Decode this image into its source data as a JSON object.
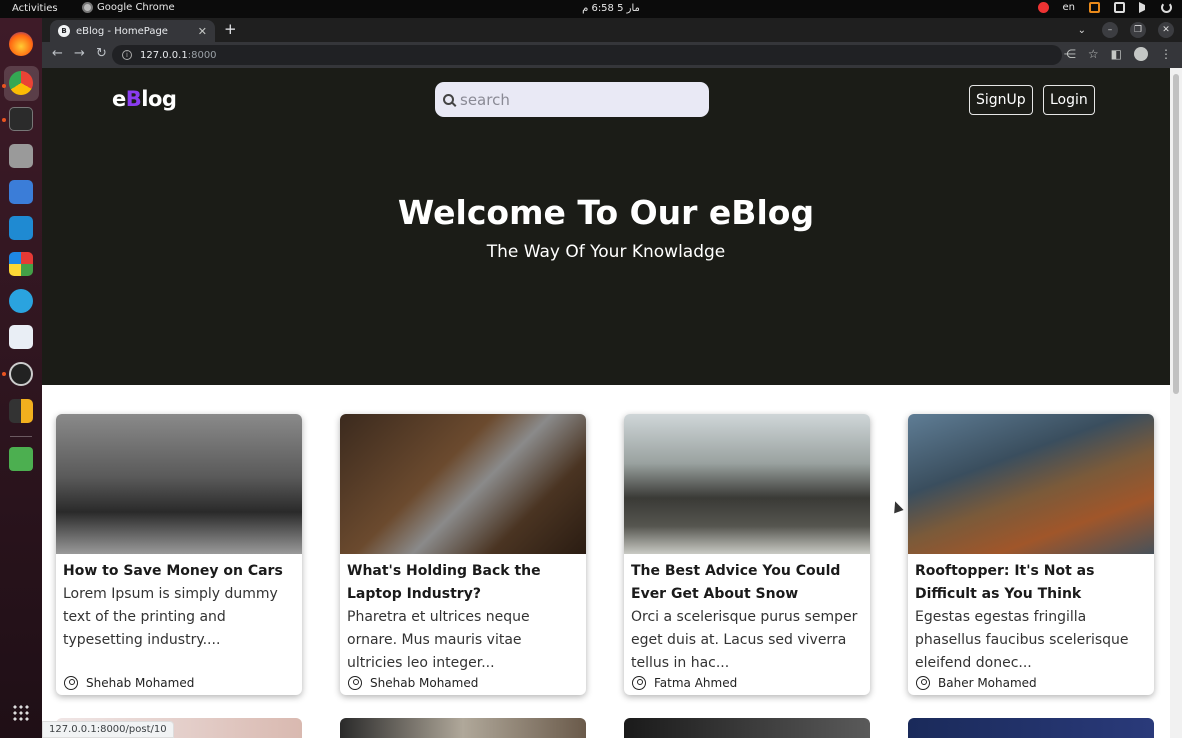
{
  "system": {
    "activities": "Activities",
    "app_name": "Google Chrome",
    "clock": "مار 5  6:58 م",
    "lang": "en"
  },
  "browser": {
    "tab_title": "eBlog - HomePage",
    "tab_favicon": "B",
    "url_host": "127.0.0.1",
    "url_port": ":8000",
    "status_url": "127.0.0.1:8000/post/10"
  },
  "header": {
    "logo_prefix": "e",
    "logo_accent": "B",
    "logo_rest": "log",
    "search_placeholder": "search",
    "signup_label": "SignUp",
    "login_label": "Login"
  },
  "hero": {
    "title": "Welcome To Our eBlog",
    "subtitle": "The Way Of Your Knowladge"
  },
  "colors": {
    "hero_bg": "#1b1c17",
    "logo_accent": "#8a3cf0"
  },
  "posts": [
    {
      "title": "How to Save Money on Cars",
      "excerpt": "Lorem Ipsum is simply dummy text of the printing and typesetting industry....",
      "author": "Shehab Mohamed"
    },
    {
      "title": "What's Holding Back the Laptop Industry?",
      "excerpt": "Pharetra et ultrices neque ornare. Mus mauris vitae ultricies leo integer...",
      "author": "Shehab Mohamed"
    },
    {
      "title": "The Best Advice You Could Ever Get About Snow",
      "excerpt": "Orci a scelerisque purus semper eget duis at. Lacus sed viverra tellus in hac...",
      "author": "Fatma Ahmed"
    },
    {
      "title": "Rooftopper: It's Not as Difficult as You Think",
      "excerpt": "Egestas egestas fringilla phasellus faucibus scelerisque eleifend donec...",
      "author": "Baher Mohamed"
    }
  ]
}
